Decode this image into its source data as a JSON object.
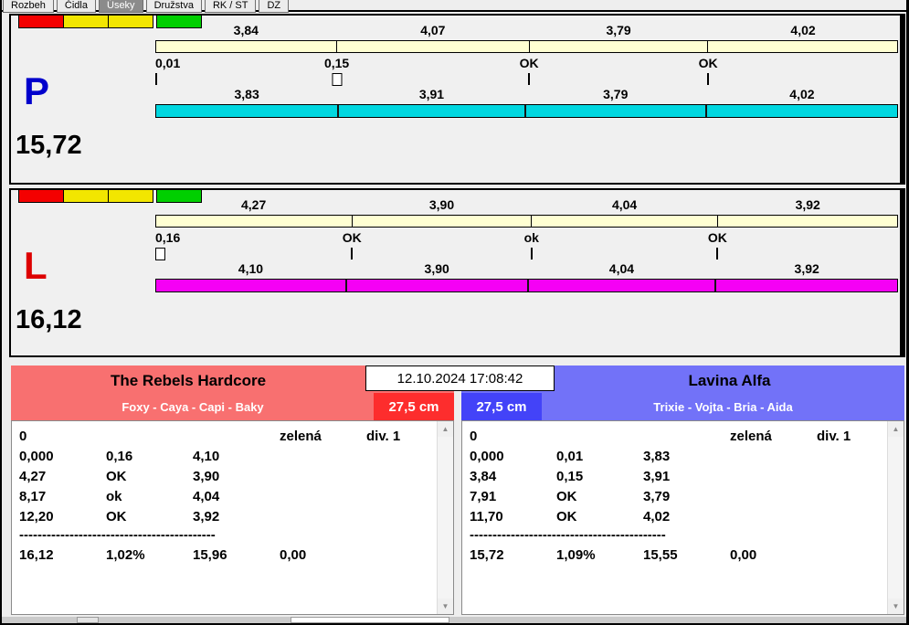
{
  "tabs": {
    "items": [
      {
        "id": "rozbeh",
        "label": "Rozbeh",
        "selected": false
      },
      {
        "id": "cidla",
        "label": "Čidla",
        "selected": false
      },
      {
        "id": "useky",
        "label": "Úseky",
        "selected": true
      },
      {
        "id": "druzstva",
        "label": "Družstva",
        "selected": false
      },
      {
        "id": "rk-st",
        "label": "RK / ST",
        "selected": false
      },
      {
        "id": "dz",
        "label": "DZ",
        "selected": false
      }
    ]
  },
  "timestamp": "12.10.2024 17:08:42",
  "lanes": [
    {
      "id": "P",
      "letter": "P",
      "letter_color": "#0000cc",
      "total_label": "15,72",
      "bar_color": "#00d7e0",
      "lights": [
        "#f40000",
        "#f2e600",
        "#f2e600",
        "#00cf00"
      ],
      "segments_top": [
        {
          "label": "3,84",
          "value": 3.84
        },
        {
          "label": "4,07",
          "value": 4.07
        },
        {
          "label": "3,79",
          "value": 3.79
        },
        {
          "label": "4,02",
          "value": 4.02
        }
      ],
      "marks": [
        {
          "label": "0,01",
          "widget": "tick"
        },
        {
          "label": "0,15",
          "widget": "checkbox"
        },
        {
          "label": "OK",
          "widget": "tick"
        },
        {
          "label": "OK",
          "widget": "tick"
        }
      ],
      "segments_bottom": [
        {
          "label": "3,83",
          "value": 3.83
        },
        {
          "label": "3,91",
          "value": 3.91
        },
        {
          "label": "3,79",
          "value": 3.79
        },
        {
          "label": "4,02",
          "value": 4.02
        }
      ]
    },
    {
      "id": "L",
      "letter": "L",
      "letter_color": "#dd0000",
      "total_label": "16,12",
      "bar_color": "#f500f5",
      "lights": [
        "#f40000",
        "#f2e600",
        "#f2e600",
        "#00cf00"
      ],
      "segments_top": [
        {
          "label": "4,27",
          "value": 4.27
        },
        {
          "label": "3,90",
          "value": 3.9
        },
        {
          "label": "4,04",
          "value": 4.04
        },
        {
          "label": "3,92",
          "value": 3.92
        }
      ],
      "marks": [
        {
          "label": "0,16",
          "widget": "checkbox"
        },
        {
          "label": "OK",
          "widget": "tick"
        },
        {
          "label": "ok",
          "widget": "tick"
        },
        {
          "label": "OK",
          "widget": "tick"
        }
      ],
      "segments_bottom": [
        {
          "label": "4,10",
          "value": 4.1
        },
        {
          "label": "3,90",
          "value": 3.9
        },
        {
          "label": "4,04",
          "value": 4.04
        },
        {
          "label": "3,92",
          "value": 3.92
        }
      ]
    }
  ],
  "teams": [
    {
      "name": "The Rebels Hardcore",
      "members": "Foxy - Caya - Capi - Baky",
      "height_class": "27,5 cm",
      "header_color": "#f87070",
      "box_color": "#fd2d2d",
      "rows": [
        {
          "cells": [
            "0",
            "",
            "",
            "zelená",
            "div. 1"
          ]
        },
        {
          "cells": [
            "0,000",
            "0,16",
            "4,10",
            "",
            ""
          ]
        },
        {
          "cells": [
            "4,27",
            "OK",
            "3,90",
            "",
            ""
          ]
        },
        {
          "cells": [
            "8,17",
            "ok",
            "4,04",
            "",
            ""
          ]
        },
        {
          "cells": [
            "12,20",
            "OK",
            "3,92",
            "",
            ""
          ]
        },
        {
          "separator": "-------------------------------------------"
        },
        {
          "cells": [
            "16,12",
            "1,02%",
            "15,96",
            "0,00",
            ""
          ]
        }
      ]
    },
    {
      "name": "Lavina Alfa",
      "members": "Trixie - Vojta - Bria - Aida",
      "height_class": "27,5 cm",
      "header_color": "#7272f8",
      "box_color": "#4343f8",
      "rows": [
        {
          "cells": [
            "0",
            "",
            "",
            "zelená",
            "div. 1"
          ]
        },
        {
          "cells": [
            "0,000",
            "0,01",
            "3,83",
            "",
            ""
          ]
        },
        {
          "cells": [
            "3,84",
            "0,15",
            "3,91",
            "",
            ""
          ]
        },
        {
          "cells": [
            "7,91",
            "OK",
            "3,79",
            "",
            ""
          ]
        },
        {
          "cells": [
            "11,70",
            "OK",
            "4,02",
            "",
            ""
          ]
        },
        {
          "separator": "-------------------------------------------"
        },
        {
          "cells": [
            "15,72",
            "1,09%",
            "15,55",
            "0,00",
            ""
          ]
        }
      ]
    }
  ],
  "scrollbar": {
    "up": "▲",
    "down": "▼"
  }
}
